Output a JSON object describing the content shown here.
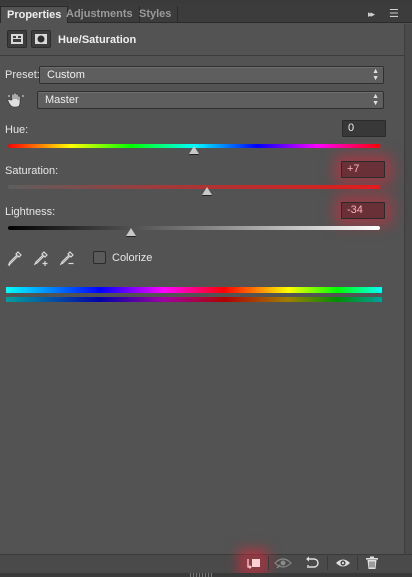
{
  "tabs": [
    {
      "label": "Properties"
    },
    {
      "label": "Adjustments"
    },
    {
      "label": "Styles"
    }
  ],
  "panel": {
    "title": "Hue/Saturation",
    "collapse_glyph": "▸▸",
    "menu_glyph": "☰"
  },
  "preset": {
    "label": "Preset:",
    "value": "Custom"
  },
  "channel": {
    "value": "Master"
  },
  "sliders": {
    "hue": {
      "label": "Hue:",
      "value": "0",
      "level": 0.5
    },
    "saturation": {
      "label": "Saturation:",
      "value": "+7",
      "level": 0.535
    },
    "lightness": {
      "label": "Lightness:",
      "value": "-34",
      "level": 0.33
    }
  },
  "colorize": {
    "label": "Colorize",
    "checked": false
  },
  "footer": {
    "buttons": [
      "clip-to-layer",
      "view-previous-state",
      "reset-to-defaults",
      "toggle-visibility",
      "delete-adjustment"
    ]
  },
  "colors": {
    "panel_bg": "#535353",
    "glow": "#dc283c"
  }
}
